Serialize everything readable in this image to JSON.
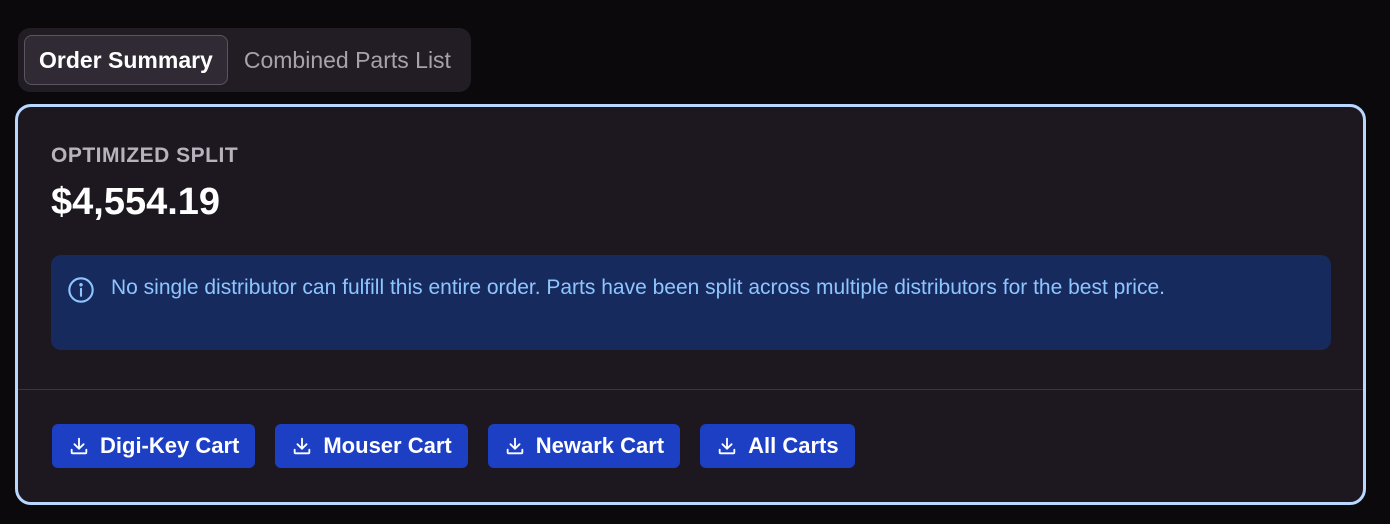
{
  "tabs": [
    {
      "label": "Order Summary",
      "active": true
    },
    {
      "label": "Combined Parts List",
      "active": false
    }
  ],
  "summary": {
    "label": "OPTIMIZED SPLIT",
    "amount": "$4,554.19"
  },
  "alert": {
    "icon": "info-icon",
    "text": "No single distributor can fulfill this entire order. Parts have been split across multiple distributors for the best price."
  },
  "actions": [
    {
      "label": "Digi-Key Cart",
      "icon": "download-icon"
    },
    {
      "label": "Mouser Cart",
      "icon": "download-icon"
    },
    {
      "label": "Newark Cart",
      "icon": "download-icon"
    },
    {
      "label": "All Carts",
      "icon": "download-icon"
    }
  ],
  "colors": {
    "background": "#0b090c",
    "card": "#1d181f",
    "card_border": "#b9d7ff",
    "alert_bg": "#172a5e",
    "alert_text": "#8ec5ff",
    "button": "#1d3fc4"
  }
}
